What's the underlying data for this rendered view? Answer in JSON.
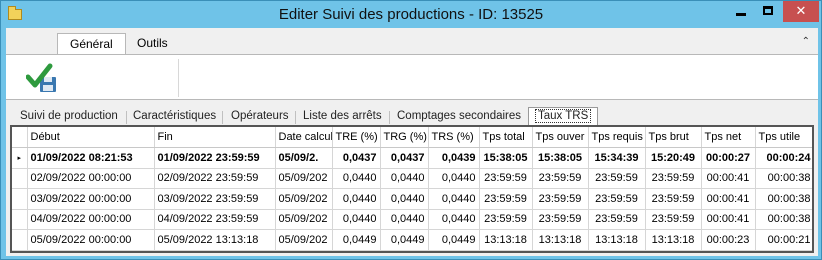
{
  "window": {
    "title": "Editer Suivi des productions - ID: 13525"
  },
  "ribbon": {
    "tabs": [
      "Général",
      "Outils"
    ],
    "active_tab": "Général",
    "collapse_icon": "chevron-up-icon",
    "save_icon": "check-save-icon"
  },
  "tabs": {
    "items": [
      "Suivi de production",
      "Caractéristiques",
      "Opérateurs",
      "Liste des arrêts",
      "Comptages secondaires",
      "Taux TRS"
    ],
    "active": "Taux TRS"
  },
  "grid": {
    "columns": [
      "Début",
      "Fin",
      "Date calcul",
      "TRE (%)",
      "TRG (%)",
      "TRS (%)",
      "Tps total",
      "Tps ouver",
      "Tps requis",
      "Tps brut",
      "Tps net",
      "Tps utile"
    ],
    "rows": [
      [
        "01/09/2022 08:21:53",
        "01/09/2022 23:59:59",
        "05/09/2.",
        "0,0437",
        "0,0437",
        "0,0439",
        "15:38:05",
        "15:38:05",
        "15:34:39",
        "15:20:49",
        "00:00:27",
        "00:00:24"
      ],
      [
        "02/09/2022 00:00:00",
        "02/09/2022 23:59:59",
        "05/09/202",
        "0,0440",
        "0,0440",
        "0,0440",
        "23:59:59",
        "23:59:59",
        "23:59:59",
        "23:59:59",
        "00:00:41",
        "00:00:38"
      ],
      [
        "03/09/2022 00:00:00",
        "03/09/2022 23:59:59",
        "05/09/202",
        "0,0440",
        "0,0440",
        "0,0440",
        "23:59:59",
        "23:59:59",
        "23:59:59",
        "23:59:59",
        "00:00:41",
        "00:00:38"
      ],
      [
        "04/09/2022 00:00:00",
        "04/09/2022 23:59:59",
        "05/09/202",
        "0,0440",
        "0,0440",
        "0,0440",
        "23:59:59",
        "23:59:59",
        "23:59:59",
        "23:59:59",
        "00:00:41",
        "00:00:38"
      ],
      [
        "05/09/2022 00:00:00",
        "05/09/2022 13:13:18",
        "05/09/202",
        "0,0449",
        "0,0449",
        "0,0449",
        "13:13:18",
        "13:13:18",
        "13:13:18",
        "13:13:18",
        "00:00:23",
        "00:00:21"
      ]
    ],
    "current_row_indicator": "▸"
  },
  "colors": {
    "titlebar": "#6fc3e8",
    "close_button": "#c75050",
    "save_check": "#2e9a3e",
    "save_disk": "#3a78b0"
  }
}
